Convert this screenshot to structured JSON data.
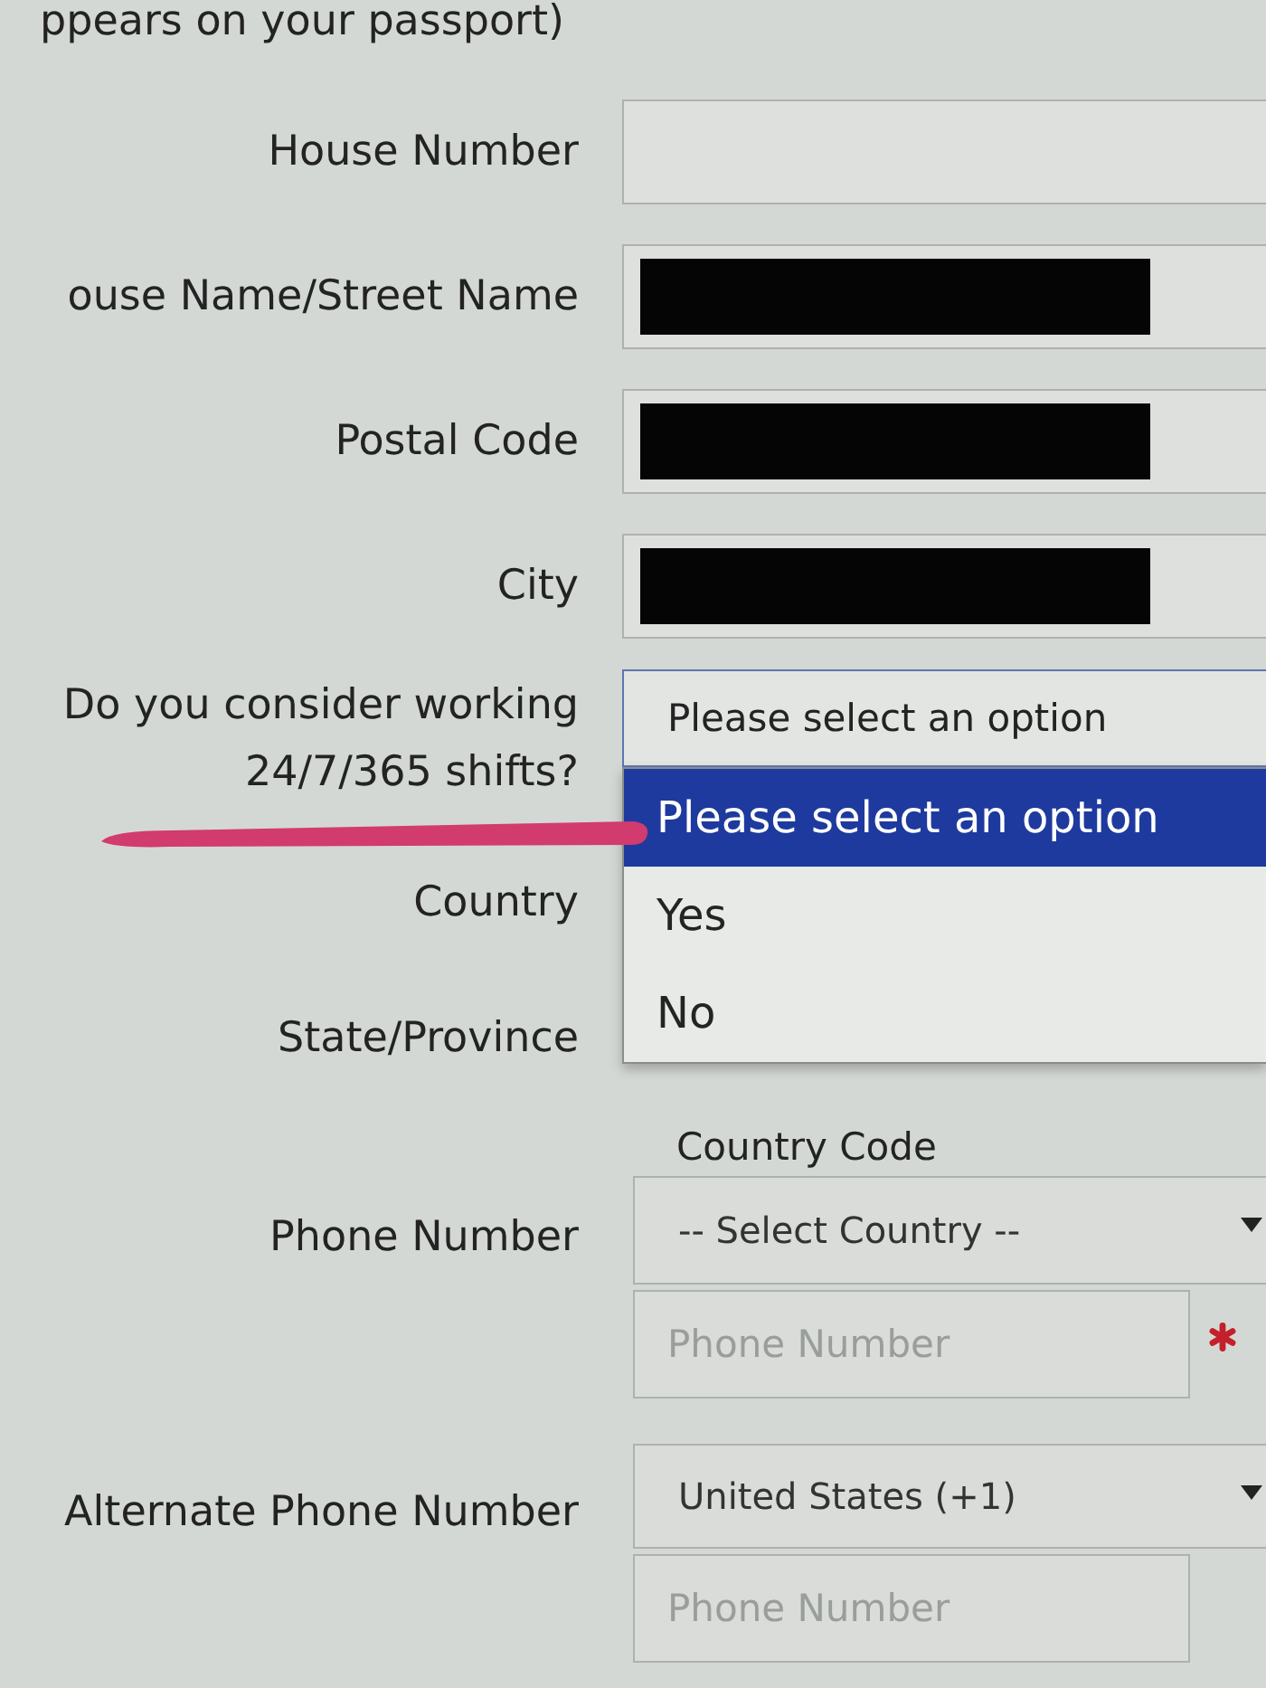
{
  "form": {
    "cut_label": "ppears on your passport)",
    "rows": [
      {
        "kind": "text",
        "label": "House Number",
        "redacted": false
      },
      {
        "kind": "text",
        "label": "ouse Name/Street Name",
        "redacted": true
      },
      {
        "kind": "text",
        "label": "Postal Code",
        "redacted": true
      },
      {
        "kind": "text",
        "label": "City",
        "redacted": true
      },
      {
        "kind": "select",
        "label": "Do you consider working 24/7/365 shifts?",
        "value": "Please select an option",
        "expanded": true,
        "options": [
          {
            "label": "Please select an option",
            "selected": true
          },
          {
            "label": "Yes",
            "selected": false
          },
          {
            "label": "No",
            "selected": false
          }
        ]
      },
      {
        "kind": "covered",
        "label": "Country"
      },
      {
        "kind": "covered",
        "label": "State/Province"
      },
      {
        "kind": "phone",
        "label": "Phone Number",
        "code_label": "Country Code",
        "country": "-- Select Country --",
        "placeholder": "Phone Number",
        "required": true
      },
      {
        "kind": "phone",
        "label": "Alternate Phone Number",
        "country": "United States (+1)",
        "placeholder": "Phone Number",
        "required": false
      }
    ]
  }
}
